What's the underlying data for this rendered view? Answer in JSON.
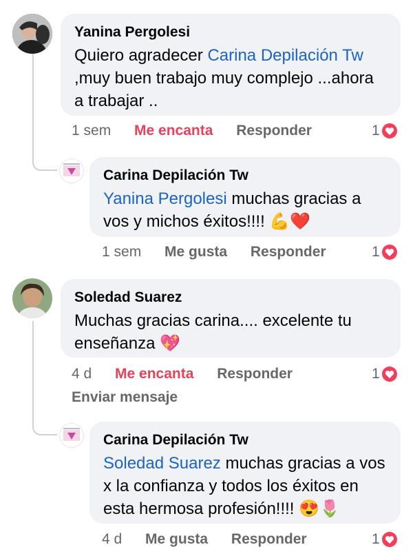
{
  "comments": [
    {
      "author": "Yanina Pergolesi",
      "mention": "Carina Depilación Tw",
      "text_pre": "Quiero agradecer ",
      "text_post": " ,muy buen trabajo muy complejo ...ahora a trabajar ..",
      "time": "1 sem",
      "reaction_label": "Me encanta",
      "reply_label": "Responder",
      "reaction_count": "1"
    },
    {
      "author": "Carina Depilación Tw",
      "mention": "Yanina Pergolesi",
      "text": " muchas gracias a vos y michos éxitos!!!! 💪❤️",
      "time": "1 sem",
      "reaction_label": "Me gusta",
      "reply_label": "Responder",
      "reaction_count": "1"
    },
    {
      "author": "Soledad Suarez",
      "text": "Muchas gracias carina.... excelente tu enseñanza 💖",
      "time": "4 d",
      "reaction_label": "Me encanta",
      "reply_label": "Responder",
      "reaction_count": "1",
      "extra_action": "Enviar mensaje"
    },
    {
      "author": "Carina Depilación Tw",
      "mention": "Soledad Suarez",
      "text": " muchas gracias a vos x la confianza y todos los éxitos en esta hermosa profesión!!!! 😍🌷",
      "time": "4 d",
      "reaction_label": "Me gusta",
      "reply_label": "Responder",
      "reaction_count": "1"
    }
  ],
  "colors": {
    "mention": "#1c63c7",
    "love": "#e8425a",
    "bubble": "#f0f2f5",
    "meta": "#65676b"
  }
}
